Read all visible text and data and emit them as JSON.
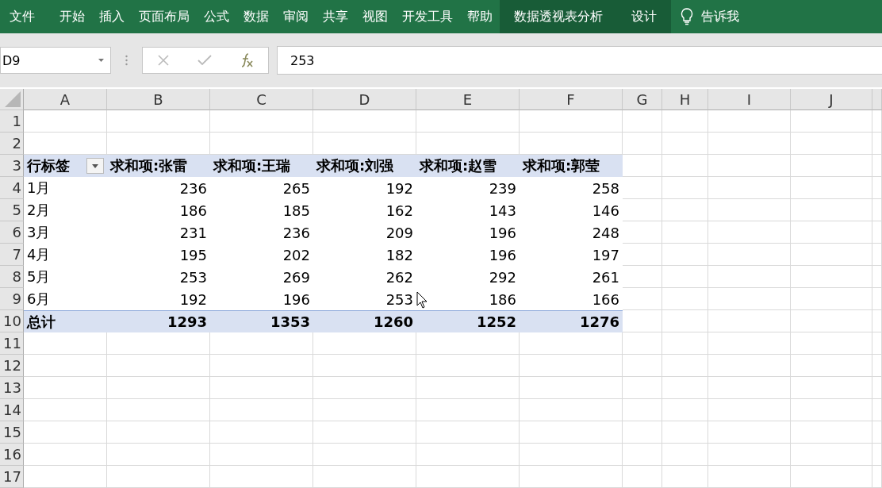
{
  "ribbon": {
    "tabs": [
      {
        "label": "文件",
        "kind": "normal"
      },
      {
        "label": "开始",
        "kind": "normal"
      },
      {
        "label": "插入",
        "kind": "normal"
      },
      {
        "label": "页面布局",
        "kind": "normal"
      },
      {
        "label": "公式",
        "kind": "normal"
      },
      {
        "label": "数据",
        "kind": "normal"
      },
      {
        "label": "审阅",
        "kind": "normal"
      },
      {
        "label": "共享",
        "kind": "normal"
      },
      {
        "label": "视图",
        "kind": "normal"
      },
      {
        "label": "开发工具",
        "kind": "normal"
      },
      {
        "label": "帮助",
        "kind": "normal"
      },
      {
        "label": "数据透视表分析",
        "kind": "contextual"
      },
      {
        "label": "设计",
        "kind": "contextual"
      }
    ],
    "tell_me": "告诉我"
  },
  "formula_bar": {
    "name_box": "D9",
    "formula": "253"
  },
  "columns": [
    "A",
    "B",
    "C",
    "D",
    "E",
    "F",
    "G",
    "H",
    "I",
    "J"
  ],
  "rows": [
    {
      "number": "1",
      "kind": "empty"
    },
    {
      "number": "2",
      "kind": "empty"
    },
    {
      "number": "3",
      "kind": "pivot_header",
      "label": "行标签",
      "cells": [
        "求和项:张雷",
        "求和项:王瑞",
        "求和项:刘强",
        "求和项:赵雪",
        "求和项:郭莹"
      ]
    },
    {
      "number": "4",
      "kind": "data",
      "label": "1月",
      "cells": [
        "236",
        "265",
        "192",
        "239",
        "258"
      ]
    },
    {
      "number": "5",
      "kind": "data",
      "label": "2月",
      "cells": [
        "186",
        "185",
        "162",
        "143",
        "146"
      ]
    },
    {
      "number": "6",
      "kind": "data",
      "label": "3月",
      "cells": [
        "231",
        "236",
        "209",
        "196",
        "248"
      ]
    },
    {
      "number": "7",
      "kind": "data",
      "label": "4月",
      "cells": [
        "195",
        "202",
        "182",
        "196",
        "197"
      ]
    },
    {
      "number": "8",
      "kind": "data",
      "label": "5月",
      "cells": [
        "253",
        "269",
        "262",
        "292",
        "261"
      ]
    },
    {
      "number": "9",
      "kind": "data",
      "label": "6月",
      "cells": [
        "192",
        "196",
        "253",
        "186",
        "166"
      ]
    },
    {
      "number": "10",
      "kind": "total",
      "label": "总计",
      "cells": [
        "1293",
        "1353",
        "1260",
        "1252",
        "1276"
      ]
    },
    {
      "number": "11",
      "kind": "empty"
    },
    {
      "number": "12",
      "kind": "empty"
    },
    {
      "number": "13",
      "kind": "empty"
    },
    {
      "number": "14",
      "kind": "empty"
    },
    {
      "number": "15",
      "kind": "empty"
    },
    {
      "number": "16",
      "kind": "empty"
    },
    {
      "number": "17",
      "kind": "empty"
    }
  ]
}
